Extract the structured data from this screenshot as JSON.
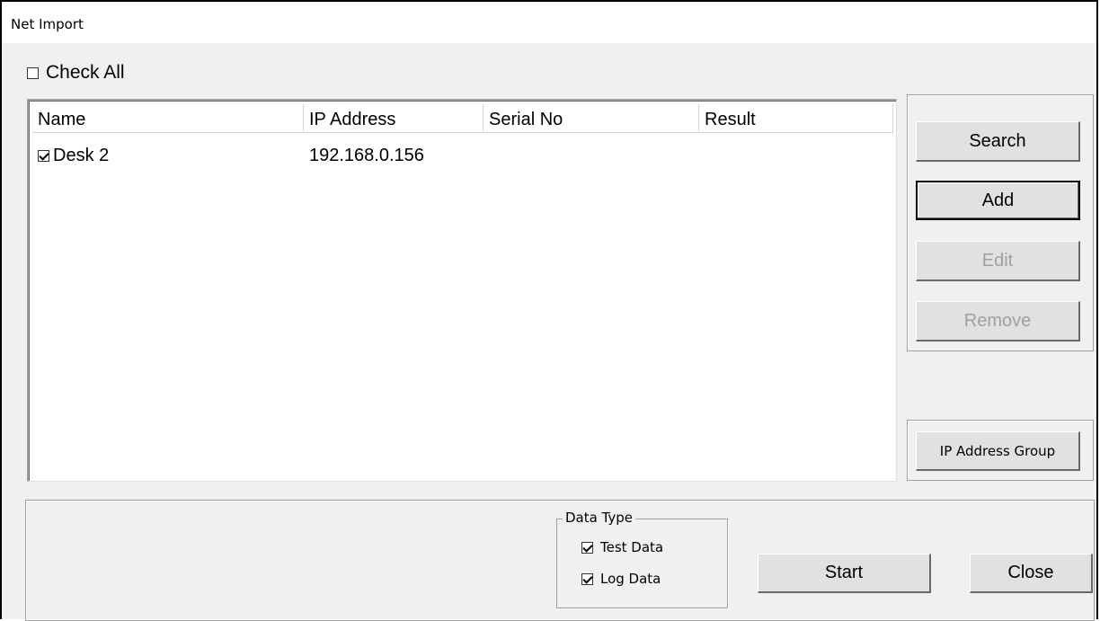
{
  "window": {
    "title": "Net Import"
  },
  "check_all": {
    "label": "Check All",
    "checked": false
  },
  "list": {
    "columns": [
      "Name",
      "IP Address",
      "Serial No",
      "Result"
    ],
    "rows": [
      {
        "name": "Desk 2",
        "ip": "192.168.0.156",
        "serial": "",
        "result": "",
        "checked": true
      }
    ]
  },
  "buttons": {
    "search": "Search",
    "add": "Add",
    "edit": "Edit",
    "remove": "Remove",
    "ip_group": "IP Address Group",
    "start": "Start",
    "close": "Close"
  },
  "data_type": {
    "legend": "Data Type",
    "test_data": {
      "label": "Test Data",
      "checked": true
    },
    "log_data": {
      "label": "Log Data",
      "checked": true
    }
  }
}
